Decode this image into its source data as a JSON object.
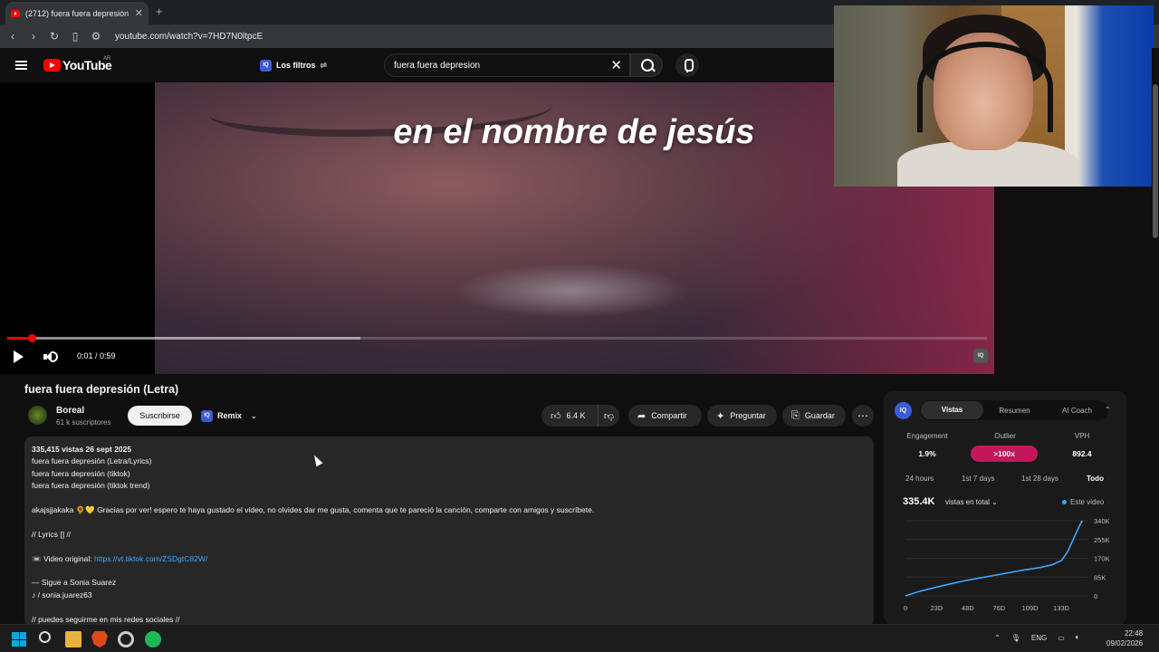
{
  "browser": {
    "tab_title": "(2712) fuera fuera depresión",
    "url": "youtube.com/watch?v=7HD7N0ltpcE"
  },
  "header": {
    "logo_text": "YouTube",
    "country": "AR",
    "filters_label": "Los filtros",
    "search_value": "fuera fuera depresion"
  },
  "player": {
    "caption": "en el nombre de jesús",
    "time": "0:01 / 0:59",
    "progress_played_fraction": 0.025,
    "progress_loaded_fraction": 0.36
  },
  "video": {
    "title": "fuera fuera depresión (Letra)",
    "channel": "Boreal",
    "subscribers": "61 k suscriptores",
    "subscribe_label": "Suscribirse",
    "remix_label": "Remix",
    "likes": "6.4 K",
    "share_label": "Compartir",
    "ask_label": "Preguntar",
    "save_label": "Guardar"
  },
  "description": {
    "stats": "335,415 vistas  26 sept 2025",
    "lines": [
      "fuera fuera depresión (Letra/Lyrics)",
      "fuera fuera depresión (tiktok)",
      "fuera fuera depresión (tiktok trend)"
    ],
    "body": "akajsjjakaka 🌻💛 Gracias por ver! espero te haya gustado el video, no olvides dar me gusta, comenta que te pareció la canción, comparte con amigos y suscríbete.",
    "lyrics": "// Lyrics [] //",
    "original_label": "📼 Video original: ",
    "original_link": "https://vt.tiktok.com/ZSDgtC82W/",
    "follow": "— Sigue a Sonia Suarez",
    "handle": "♪ / sonia.juarez63",
    "socials": "// puedes seguirme en mis redes sociales //"
  },
  "panel": {
    "badge": "IQ",
    "tabs": [
      "Vistas",
      "Resumen",
      "AI Coach"
    ],
    "metrics": [
      {
        "label": "Engagement",
        "value": "1.9%"
      },
      {
        "label": "Outlier",
        "value": ">100x"
      },
      {
        "label": "VPH",
        "value": "892.4"
      }
    ],
    "ranges": [
      "24 hours",
      "1st 7 days",
      "1st 28 days",
      "Todo"
    ],
    "total_views": "335.4K",
    "total_label": "vistas en total ⌄",
    "legend": "Este video",
    "accent": "#3ea6ff"
  },
  "chart_data": {
    "type": "line",
    "title": "",
    "xlabel": "",
    "ylabel": "",
    "x_ticks": [
      "0",
      "23D",
      "48D",
      "76D",
      "109D",
      "133D"
    ],
    "y_ticks": [
      "340K",
      "255K",
      "170K",
      "85K",
      "0"
    ],
    "ylim": [
      0,
      340000
    ],
    "xlim": [
      0,
      150
    ],
    "series": [
      {
        "values": [
          [
            0,
            0
          ],
          [
            10,
            18000
          ],
          [
            20,
            32000
          ],
          [
            35,
            52000
          ],
          [
            50,
            70000
          ],
          [
            65,
            85000
          ],
          [
            80,
            100000
          ],
          [
            95,
            115000
          ],
          [
            110,
            128000
          ],
          [
            120,
            140000
          ],
          [
            128,
            160000
          ],
          [
            133,
            200000
          ],
          [
            138,
            260000
          ],
          [
            143,
            320000
          ],
          [
            145,
            340000
          ]
        ]
      }
    ]
  },
  "taskbar": {
    "lang": "ENG",
    "time": "22:48",
    "date": "09/02/2026"
  }
}
